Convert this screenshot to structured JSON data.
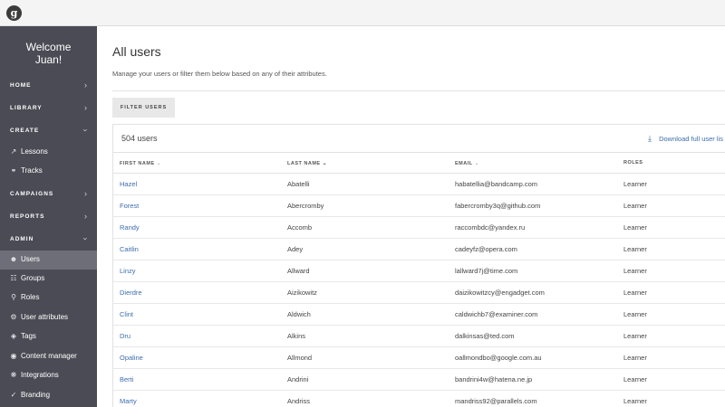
{
  "app": {
    "logo_letter": "g"
  },
  "sidebar": {
    "welcome_line1": "Welcome",
    "welcome_line2": "Juan!",
    "sections": {
      "home": "HOME",
      "library": "LIBRARY",
      "create": "CREATE",
      "campaigns": "CAMPAIGNS",
      "reports": "REPORTS",
      "admin": "ADMIN"
    },
    "create_items": [
      "Lessons",
      "Tracks"
    ],
    "admin_items": [
      "Users",
      "Groups",
      "Roles",
      "User attributes",
      "Tags",
      "Content manager",
      "Integrations",
      "Branding"
    ],
    "active_item": "Users"
  },
  "main": {
    "title": "All users",
    "subtitle": "Manage your users or filter them below based on any of their attributes.",
    "filter_button": "FILTER USERS",
    "count": "504 users",
    "download_label": "Download full user lis",
    "columns": [
      "FIRST NAME",
      "LAST NAME",
      "EMAIL",
      "ROLES"
    ],
    "rows": [
      [
        "Hazel",
        "Abatelli",
        "habatellia@bandcamp.com",
        "Learner"
      ],
      [
        "Forest",
        "Abercromby",
        "fabercromby3q@github.com",
        "Learner"
      ],
      [
        "Randy",
        "Accomb",
        "raccombdc@yandex.ru",
        "Learner"
      ],
      [
        "Caitlin",
        "Adey",
        "cadeyfz@opera.com",
        "Learner"
      ],
      [
        "Linzy",
        "Allward",
        "lallward7j@time.com",
        "Learner"
      ],
      [
        "Dierdre",
        "Aizikowitz",
        "daizikowitzcy@engadget.com",
        "Learner"
      ],
      [
        "Clint",
        "Aldwich",
        "caldwichb7@examiner.com",
        "Learner"
      ],
      [
        "Dru",
        "Alkins",
        "dalkinsas@ted.com",
        "Learner"
      ],
      [
        "Opaline",
        "Allmond",
        "oallmondbo@google.com.au",
        "Learner"
      ],
      [
        "Berti",
        "Andrini",
        "bandrini4w@hatena.ne.jp",
        "Learner"
      ],
      [
        "Marty",
        "Andriss",
        "mandriss92@parallels.com",
        "Learner"
      ]
    ]
  }
}
